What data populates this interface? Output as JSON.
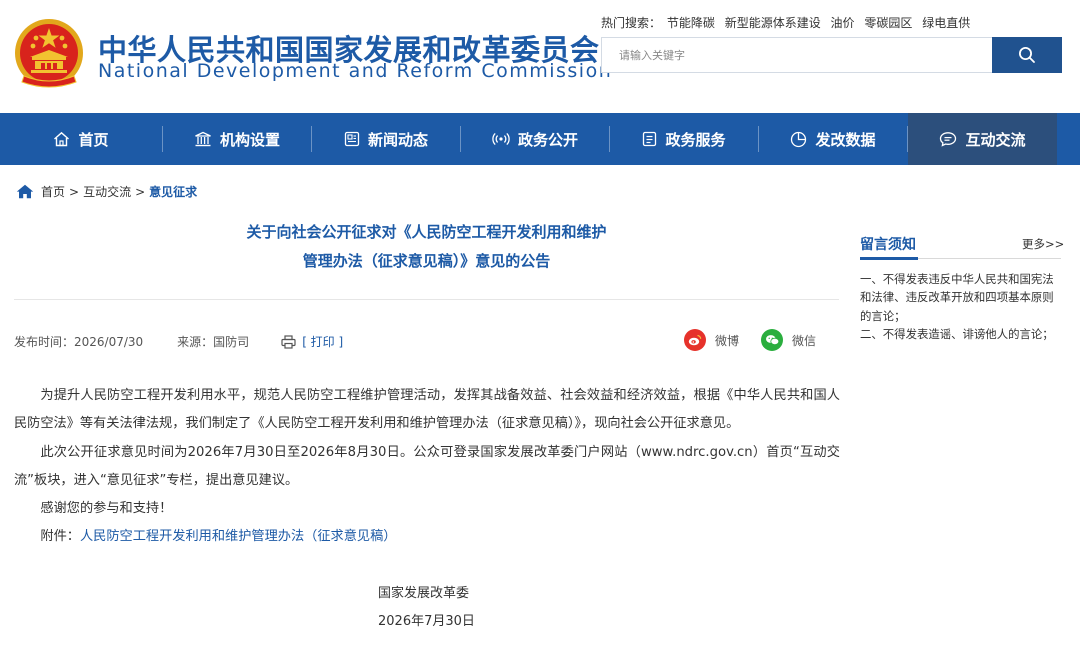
{
  "header": {
    "site_name_cn": "中华人民共和国国家发展和改革委员会",
    "site_name_en": "National Development and Reform Commission",
    "hot_search_label": "热门搜索：",
    "hot_terms": [
      "节能降碳",
      "新型能源体系建设",
      "油价",
      "零碳园区",
      "绿电直供"
    ],
    "search_placeholder": "请输入关键字"
  },
  "nav": {
    "items": [
      {
        "label": "首页",
        "icon": "home-icon"
      },
      {
        "label": "机构设置",
        "icon": "institution-icon"
      },
      {
        "label": "新闻动态",
        "icon": "news-icon"
      },
      {
        "label": "政务公开",
        "icon": "broadcast-icon"
      },
      {
        "label": "政务服务",
        "icon": "document-icon"
      },
      {
        "label": "发改数据",
        "icon": "chart-pie-icon"
      },
      {
        "label": "互动交流",
        "icon": "chat-icon",
        "active": true
      }
    ]
  },
  "breadcrumb": {
    "items": [
      "首页",
      "互动交流"
    ],
    "current": "意见征求",
    "separator": ">"
  },
  "article": {
    "title_line1": "关于向社会公开征求对《人民防空工程开发利用和维护",
    "title_line2": "管理办法（征求意见稿）》意见的公告",
    "meta": {
      "publish_time": "发布时间：2026/07/30",
      "source": "来源：国防司",
      "print_label": "[ 打印 ]"
    },
    "share": {
      "weibo_label": "微博",
      "wechat_label": "微信"
    },
    "paragraphs": {
      "p1": "为提升人民防空工程开发利用水平，规范人民防空工程维护管理活动，发挥其战备效益、社会效益和经济效益，根据《中华人民共和国人民防空法》等有关法律法规，我们制定了《人民防空工程开发利用和维护管理办法（征求意见稿）》，现向社会公开征求意见。",
      "p2": "此次公开征求意见时间为2026年7月30日至2026年8月30日。公众可登录国家发展改革委门户网站（www.ndrc.gov.cn）首页“互动交流”板块，进入“意见征求”专栏，提出意见建议。",
      "p3": "感谢您的参与和支持！",
      "attachment_label": "附件：",
      "attachment_link": "人民防空工程开发利用和维护管理办法（征求意见稿）"
    },
    "signature": {
      "org": "国家发展改革委",
      "date": "2026年7月30日"
    }
  },
  "sidebar": {
    "title": "留言须知",
    "more": "更多>>",
    "rule1": "一、不得发表违反中华人民共和国宪法和法律、违反改革开放和四项基本原则的言论；",
    "rule2": "二、不得发表造谣、诽谤他人的言论；"
  },
  "colors": {
    "brand_blue": "#1d5aa6",
    "nav_active": "#2c4f7c",
    "search_button": "#20528f",
    "weibo_red": "#e6322b",
    "wechat_green": "#2aae3e",
    "emblem_red": "#d8231c",
    "emblem_gold": "#f2c230"
  }
}
